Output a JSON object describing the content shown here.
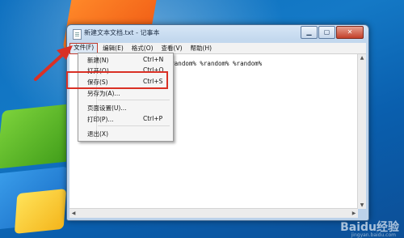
{
  "window": {
    "title": "新建文本文档.txt - 记事本",
    "buttons": {
      "minimize": "▁",
      "maximize": "▢",
      "close": "✕"
    }
  },
  "menubar": [
    {
      "label": "文件(F)"
    },
    {
      "label": "编辑(E)"
    },
    {
      "label": "格式(O)"
    },
    {
      "label": "查看(V)"
    },
    {
      "label": "帮助(H)"
    }
  ],
  "file_menu": {
    "items": [
      {
        "label": "新建(N)",
        "shortcut": "Ctrl+N"
      },
      {
        "label": "打开(O)...",
        "shortcut": "Ctrl+O"
      },
      {
        "label": "保存(S)",
        "shortcut": "Ctrl+S"
      },
      {
        "label": "另存为(A)...",
        "shortcut": ""
      },
      {
        "label": "页面设置(U)...",
        "shortcut": ""
      },
      {
        "label": "打印(P)...",
        "shortcut": "Ctrl+P"
      },
      {
        "label": "退出(X)",
        "shortcut": ""
      }
    ]
  },
  "document": {
    "text": "random% %random% %random% %random% %random%"
  },
  "annotation": {
    "color": "#d93025"
  },
  "watermark": "Baidu经验",
  "watermark_sub": "jingyan.baidu.com"
}
